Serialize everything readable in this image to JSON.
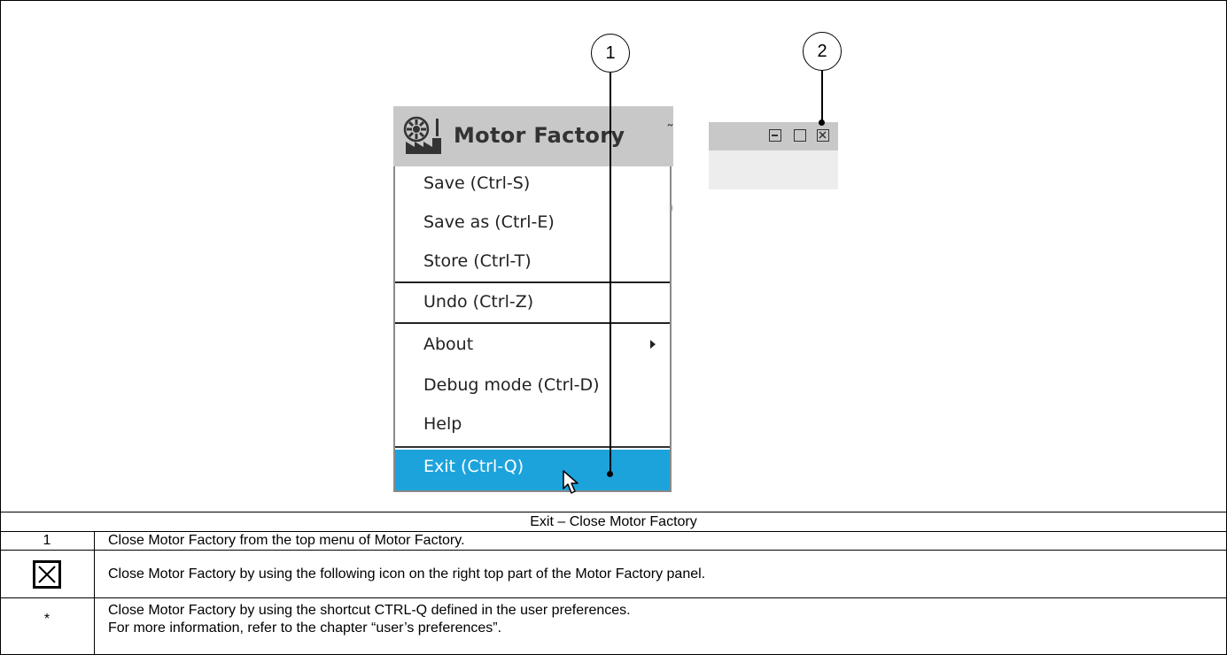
{
  "app": {
    "title": "Motor Factory",
    "title_overflow": "˜"
  },
  "menu": {
    "items": [
      {
        "label": "Save (Ctrl-S)"
      },
      {
        "label": "Save as (Ctrl-E)"
      },
      {
        "label": "Store (Ctrl-T)"
      },
      {
        "label": "Undo (Ctrl-Z)"
      },
      {
        "label": "About"
      },
      {
        "label": "Debug mode (Ctrl-D)"
      },
      {
        "label": "Help"
      }
    ],
    "exit_label": "Exit (Ctrl-Q)",
    "highlight_color": "#1ca3dc"
  },
  "callouts": {
    "one": "1",
    "two": "2"
  },
  "table": {
    "caption": "Exit – Close Motor Factory",
    "rows": [
      {
        "key": "1",
        "text": "Close Motor Factory from the top menu of Motor Factory."
      },
      {
        "key_icon": "close-box-icon",
        "text": "Close Motor Factory by using the following icon on the right top part of the Motor Factory panel."
      },
      {
        "key": "*",
        "text": "Close Motor Factory by using the shortcut CTRL-Q defined in the user preferences.",
        "text2": "For more information, refer to the chapter “user’s preferences”."
      }
    ]
  }
}
